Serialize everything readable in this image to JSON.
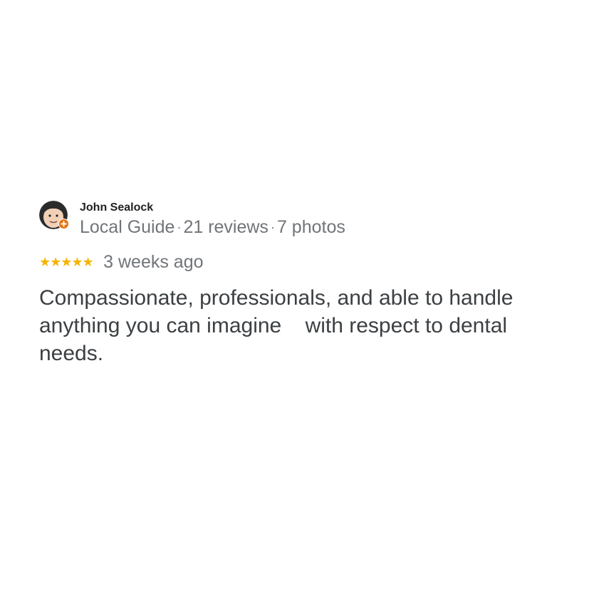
{
  "review": {
    "reviewer_name": "John Sealock",
    "reviewer_role": "Local Guide",
    "review_count": "21 reviews",
    "photo_count": "7 photos",
    "separator": "·",
    "rating": 5,
    "rating_max": 5,
    "stars": "★★★★★",
    "date": "3 weeks ago",
    "text": "Compassionate, professionals, and able to handle anything you can imagine    with respect to dental needs."
  },
  "colors": {
    "star": "#f4b400",
    "guide_badge": "#e8710a",
    "meta_text": "#70757a",
    "body_text": "#3c4043"
  },
  "icons": {
    "avatar": "cartoon-face-avatar",
    "badge": "local-guide-badge-icon"
  }
}
